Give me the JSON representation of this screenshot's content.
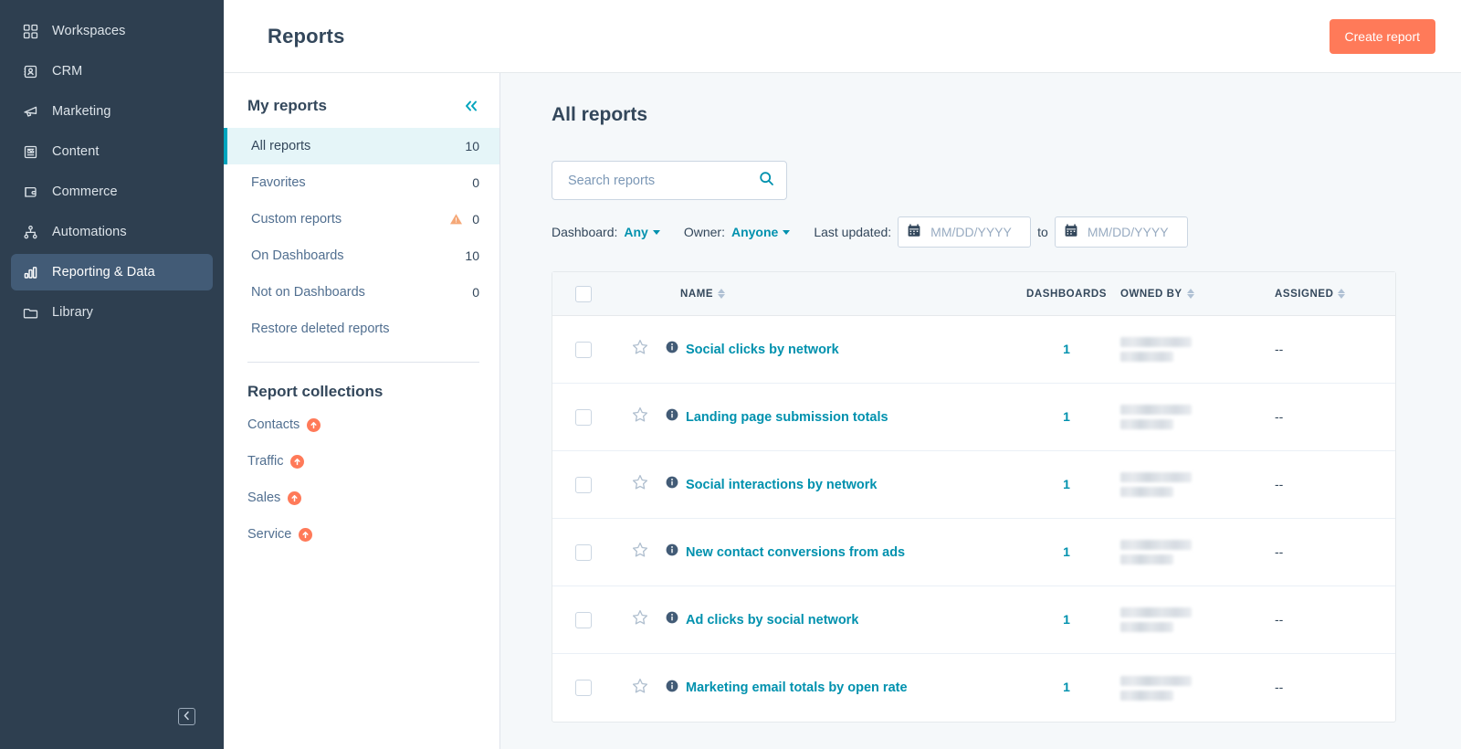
{
  "colors": {
    "nav_bg": "#2E3F50",
    "nav_active": "#425B76",
    "brand_orange": "#FF7A59",
    "link_teal": "#0091AE",
    "accent_cyan": "#00A4BD",
    "page_bg": "#F5F8FA",
    "text_dark": "#33475B"
  },
  "global_nav": {
    "items": [
      {
        "label": "Workspaces",
        "icon": "grid-icon",
        "active": false
      },
      {
        "label": "CRM",
        "icon": "contact-card-icon",
        "active": false
      },
      {
        "label": "Marketing",
        "icon": "megaphone-icon",
        "active": false
      },
      {
        "label": "Content",
        "icon": "document-icon",
        "active": false
      },
      {
        "label": "Commerce",
        "icon": "wallet-icon",
        "active": false
      },
      {
        "label": "Automations",
        "icon": "workflow-icon",
        "active": false
      },
      {
        "label": "Reporting & Data",
        "icon": "bar-chart-icon",
        "active": true
      },
      {
        "label": "Library",
        "icon": "folder-icon",
        "active": false
      }
    ],
    "collapse_icon": "chevron-left-icon"
  },
  "header": {
    "title": "Reports",
    "create_button": "Create report"
  },
  "subnav": {
    "title": "My reports",
    "collapse_icon": "double-chevron-left-icon",
    "items": [
      {
        "label": "All reports",
        "count": "10",
        "active": true,
        "warning": false
      },
      {
        "label": "Favorites",
        "count": "0",
        "active": false,
        "warning": false
      },
      {
        "label": "Custom reports",
        "count": "0",
        "active": false,
        "warning": true
      },
      {
        "label": "On Dashboards",
        "count": "10",
        "active": false,
        "warning": false
      },
      {
        "label": "Not on Dashboards",
        "count": "0",
        "active": false,
        "warning": false
      },
      {
        "label": "Restore deleted reports",
        "count": "",
        "active": false,
        "warning": false
      }
    ],
    "collections_title": "Report collections",
    "collections": [
      {
        "label": "Contacts",
        "upgrade": true
      },
      {
        "label": "Traffic",
        "upgrade": true
      },
      {
        "label": "Sales",
        "upgrade": true
      },
      {
        "label": "Service",
        "upgrade": true
      }
    ]
  },
  "main": {
    "title": "All reports",
    "search": {
      "value": "",
      "placeholder": "Search reports"
    },
    "filters": {
      "dashboard_label": "Dashboard:",
      "dashboard_value": "Any",
      "owner_label": "Owner:",
      "owner_value": "Anyone",
      "last_updated_label": "Last updated:",
      "date_from": {
        "value": "",
        "placeholder": "MM/DD/YYYY"
      },
      "date_to_separator": "to",
      "date_to": {
        "value": "",
        "placeholder": "MM/DD/YYYY"
      }
    },
    "table": {
      "columns": [
        {
          "label": "NAME",
          "sortable": true
        },
        {
          "label": "DASHBOARDS",
          "sortable": false
        },
        {
          "label": "OWNED BY",
          "sortable": true
        },
        {
          "label": "ASSIGNED",
          "sortable": true
        }
      ],
      "rows": [
        {
          "name": "Social clicks by network",
          "dashboards": "1",
          "owner": "redacted",
          "assigned": "--",
          "favorite": false,
          "selected": false
        },
        {
          "name": "Landing page submission totals",
          "dashboards": "1",
          "owner": "redacted",
          "assigned": "--",
          "favorite": false,
          "selected": false
        },
        {
          "name": "Social interactions by network",
          "dashboards": "1",
          "owner": "redacted",
          "assigned": "--",
          "favorite": false,
          "selected": false
        },
        {
          "name": "New contact conversions from ads",
          "dashboards": "1",
          "owner": "redacted",
          "assigned": "--",
          "favorite": false,
          "selected": false
        },
        {
          "name": "Ad clicks by social network",
          "dashboards": "1",
          "owner": "redacted",
          "assigned": "--",
          "favorite": false,
          "selected": false
        },
        {
          "name": "Marketing email totals by open rate",
          "dashboards": "1",
          "owner": "redacted",
          "assigned": "--",
          "favorite": false,
          "selected": false
        }
      ]
    }
  }
}
